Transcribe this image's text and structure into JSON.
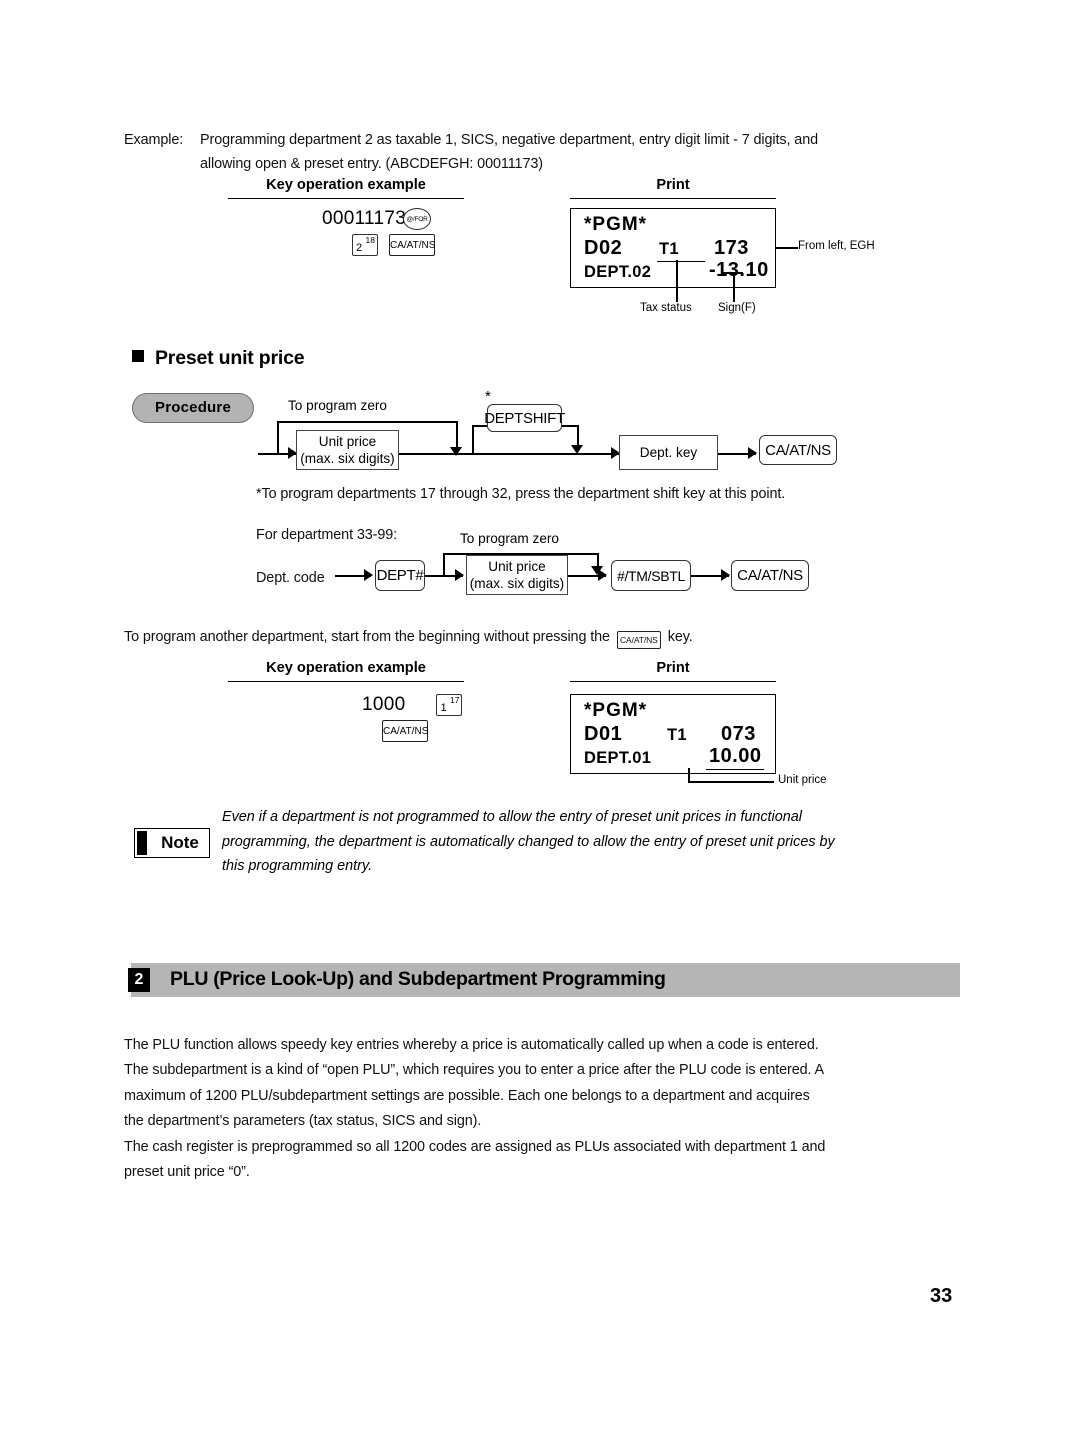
{
  "page": {
    "number": "33"
  },
  "example_intro": {
    "label": "Example:",
    "line1": "Programming department 2 as taxable 1, SICS, negative department, entry digit limit - 7 digits, and",
    "line2": "allowing open & preset entry.  (ABCDEFGH: 00011173)"
  },
  "example1": {
    "key_col_heading": "Key operation example",
    "print_col_heading": "Print",
    "entry_digits": "00011173",
    "at_for_key": "@/FOR",
    "dept_key_num": "2",
    "dept_key_sup": "18",
    "ca_at_ns_key": "CA/AT/NS",
    "receipt": {
      "line1": "*PGM*",
      "line2_left": "D02",
      "line2_mid": "T1",
      "line2_right": "173",
      "line3_left": "DEPT.02",
      "line3_right": "-13.10"
    },
    "callout_right": "From left, EGH",
    "callout_tax": "Tax status",
    "callout_sign": "Sign(F)"
  },
  "preset_section": {
    "heading": "Preset unit price",
    "procedure_label": "Procedure",
    "flow1": {
      "zero_label": "To program zero",
      "unit_price_l1": "Unit price",
      "unit_price_l2": "(max. six digits)",
      "asterisk": "*",
      "deptshift_key": "DEPTSHIFT",
      "dept_key": "Dept. key",
      "ca_at_ns_key": "CA/AT/NS"
    },
    "footnote": "*To program departments 17 through 32, press the department shift key at this point.",
    "for_dept_label": "For department 33-99:",
    "flow2": {
      "dept_code": "Dept. code",
      "dept_hash_key": "DEPT#",
      "zero_label": "To program zero",
      "unit_price_l1": "Unit price",
      "unit_price_l2": "(max. six digits)",
      "tm_sbtl_key": "#/TM/SBTL",
      "ca_at_ns_key": "CA/AT/NS"
    },
    "another_dept_pre": "To program another department, start from the beginning without pressing the",
    "another_dept_key": "CA/AT/NS",
    "another_dept_post": "key."
  },
  "example2": {
    "key_col_heading": "Key operation example",
    "print_col_heading": "Print",
    "entry_digits": "1000",
    "dept_key_num": "1",
    "dept_key_sup": "17",
    "ca_at_ns_key": "CA/AT/NS",
    "receipt": {
      "line1": "*PGM*",
      "line2_left": "D01",
      "line2_mid": "T1",
      "line2_right": "073",
      "line3_left": "DEPT.01",
      "line3_right": "10.00"
    },
    "callout_unit_price": "Unit price"
  },
  "note": {
    "badge": "Note",
    "line1": "Even if a department is not programmed to allow the entry of preset unit prices in functional",
    "line2": "programming, the department is automatically changed to allow the entry of preset unit prices by",
    "line3": "this programming entry."
  },
  "section2": {
    "number": "2",
    "title": "PLU (Price Look-Up) and Subdepartment Programming",
    "paragraph": [
      "The PLU function allows speedy key entries whereby a price is automatically called up when a code is entered.",
      "The subdepartment is a kind of “open PLU”, which requires you to enter a price after the PLU code is entered.  A",
      "maximum of 1200 PLU/subdepartment settings are possible.  Each one belongs to a department and acquires",
      "the department’s parameters (tax status, SICS and sign).",
      "The cash register is preprogrammed so all 1200 codes are assigned as PLUs associated with department 1 and",
      "preset unit price “0”."
    ]
  }
}
